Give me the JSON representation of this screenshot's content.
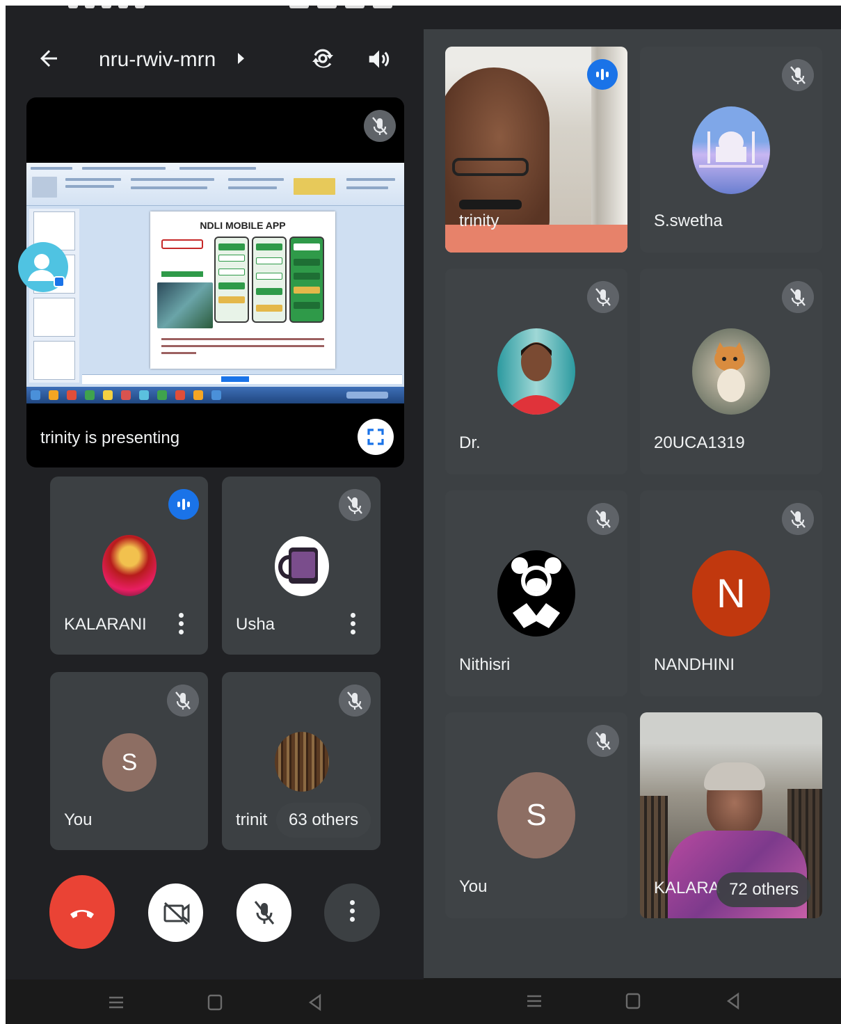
{
  "left": {
    "meeting_code": "nru-rwiv-mrn",
    "presentation": {
      "presenting_text": "trinity is presenting",
      "slide_title": "NDLI MOBILE APP"
    },
    "tiles": [
      {
        "name": "KALARANI",
        "state": "speaking",
        "avatar": "deity-photo"
      },
      {
        "name": "Usha",
        "state": "muted",
        "avatar": "mug-photo"
      },
      {
        "name": "You",
        "state": "muted",
        "avatar_letter": "S",
        "avatar_color": "#8d6e63"
      },
      {
        "name": "trinit",
        "state": "muted",
        "avatar": "library-photo",
        "others": "63 others"
      }
    ],
    "controls": [
      "end-call",
      "camera-off",
      "mic-off",
      "more-options"
    ]
  },
  "right": {
    "tiles": [
      {
        "name": "trinity",
        "state": "speaking",
        "type": "video"
      },
      {
        "name": "S.swetha",
        "state": "muted",
        "avatar": "taj-mahal-photo"
      },
      {
        "name": "Dr.",
        "state": "muted",
        "avatar": "woman-photo"
      },
      {
        "name": "20UCA1319",
        "state": "muted",
        "avatar": "kitten-photo"
      },
      {
        "name": "Nithisri",
        "state": "muted",
        "avatar": "mickey-photo"
      },
      {
        "name": "NANDHINI",
        "state": "muted",
        "avatar_letter": "N",
        "avatar_color": "#c1380e"
      },
      {
        "name": "You",
        "state": "muted",
        "avatar_letter": "S",
        "avatar_color": "#8d6e63"
      },
      {
        "name": "KALARA",
        "state": "video",
        "type": "video",
        "others": "72 others"
      }
    ]
  },
  "colors": {
    "background": "#202124",
    "tile": "#3c4043",
    "speaking_blue": "#1a73e8",
    "end_call_red": "#ea4335"
  }
}
